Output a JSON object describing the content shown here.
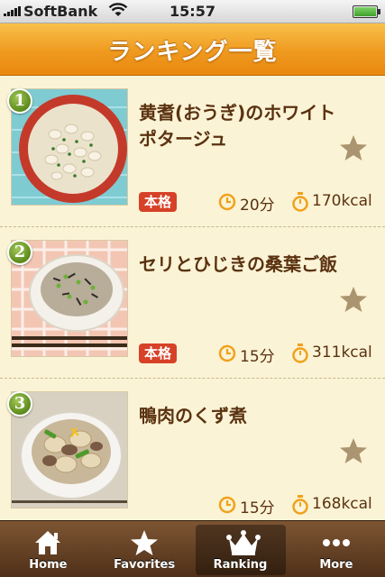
{
  "status_bar": {
    "carrier": "SoftBank",
    "time": "15:57",
    "icons": [
      "signal-icon",
      "wifi-icon",
      "battery-icon"
    ]
  },
  "nav": {
    "title": "ランキング一覧"
  },
  "recipes": [
    {
      "rank": "1",
      "title": "黄耆(おうぎ)のホワイトポタージュ",
      "badge": "本格",
      "time": "20分",
      "calories": "170kcal",
      "favorited": false
    },
    {
      "rank": "2",
      "title": "セリとひじきの桑葉ご飯",
      "badge": "本格",
      "time": "15分",
      "calories": "311kcal",
      "favorited": false
    },
    {
      "rank": "3",
      "title": "鴨肉のくず煮",
      "badge": "",
      "time": "15分",
      "calories": "168kcal",
      "favorited": false
    }
  ],
  "tabs": [
    {
      "label": "Home",
      "icon": "home-icon",
      "selected": false
    },
    {
      "label": "Favorites",
      "icon": "star-icon",
      "selected": false
    },
    {
      "label": "Ranking",
      "icon": "crown-icon",
      "selected": true
    },
    {
      "label": "More",
      "icon": "more-dots-icon",
      "selected": false
    }
  ],
  "colors": {
    "nav_orange": "#ef9a1f",
    "background": "#fbf3d6",
    "text_brown": "#5a3210",
    "badge_red": "#d64127",
    "icon_orange": "#f0a21a",
    "tabbar_brown": "#5e3a1f"
  }
}
